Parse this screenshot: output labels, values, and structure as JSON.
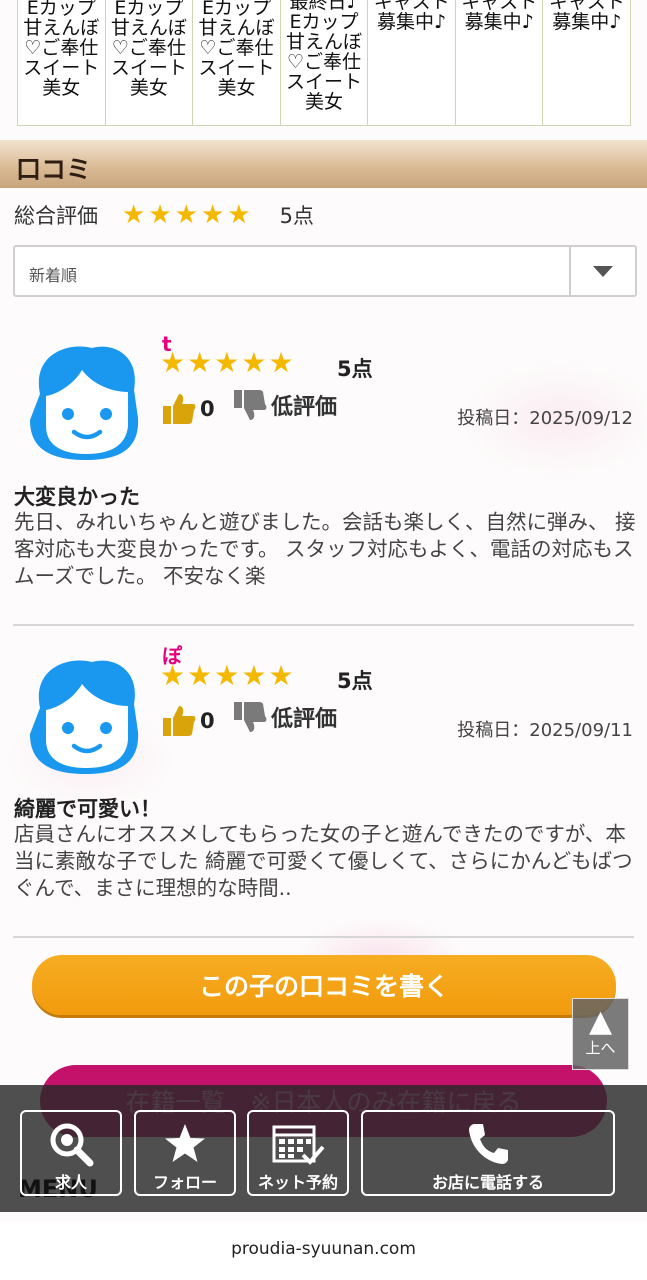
{
  "cast_strip": [
    "Eカップ\n甘えんぼ\n♡ご奉仕\nスイート\n美女",
    "Eカップ\n甘えんぼ\n♡ご奉仕\nスイート\n美女",
    "Eカップ\n甘えんぼ\n♡ご奉仕\nスイート\n美女",
    "最終日♪\nEカップ\n甘えんぼ\n♡ご奉仕\nスイート\n美女",
    "キャスト\n募集中♪",
    "キャスト\n募集中♪",
    "キャスト\n募集中♪"
  ],
  "section": {
    "title": "口コミ"
  },
  "overall": {
    "label": "総合評価",
    "stars": 5,
    "score": "5点"
  },
  "sort": {
    "selected": "新着順"
  },
  "reviews": [
    {
      "name": "t",
      "stars": 5,
      "score": "5点",
      "likes": "0",
      "dislike_label": "低評価",
      "date": "投稿日：2025/09/12",
      "title": "大変良かった",
      "body": "先日、みれいちゃんと遊びました。会話も楽しく、自然に弾み、 接客対応も大変良かったです。 スタッフ対応もよく、電話の対応もスムーズでした。 不安なく楽"
    },
    {
      "name": "ぽ",
      "stars": 5,
      "score": "5点",
      "likes": "0",
      "dislike_label": "低評価",
      "date": "投稿日：2025/09/11",
      "title": "綺麗で可愛い！",
      "body": "店員さんにオススメしてもらった女の子と遊んできたのですが、本当に素敵な子でした 綺麗で可愛くて優しくて、さらにかんどもばつぐんで、まさに理想的な時間.."
    }
  ],
  "buttons": {
    "write_review": "この子の口コミを書く",
    "back_to_list": "在籍一覧　※日本人のみ在籍に戻る",
    "scroll_top": "上へ"
  },
  "menu": {
    "label": "MENU",
    "items": [
      {
        "label": "求人",
        "icon": "search-icon"
      },
      {
        "label": "フォロー",
        "icon": "star-icon"
      },
      {
        "label": "ネット予約",
        "icon": "calendar-check-icon"
      },
      {
        "label": "お店に電話する",
        "icon": "phone-icon"
      }
    ]
  },
  "browser": {
    "url": "proudia-syuunan.com"
  },
  "colors": {
    "star": "#f5b800",
    "accent_pink": "#e4007f",
    "write_button": "#f5a31a",
    "back_button": "#c4126b"
  }
}
